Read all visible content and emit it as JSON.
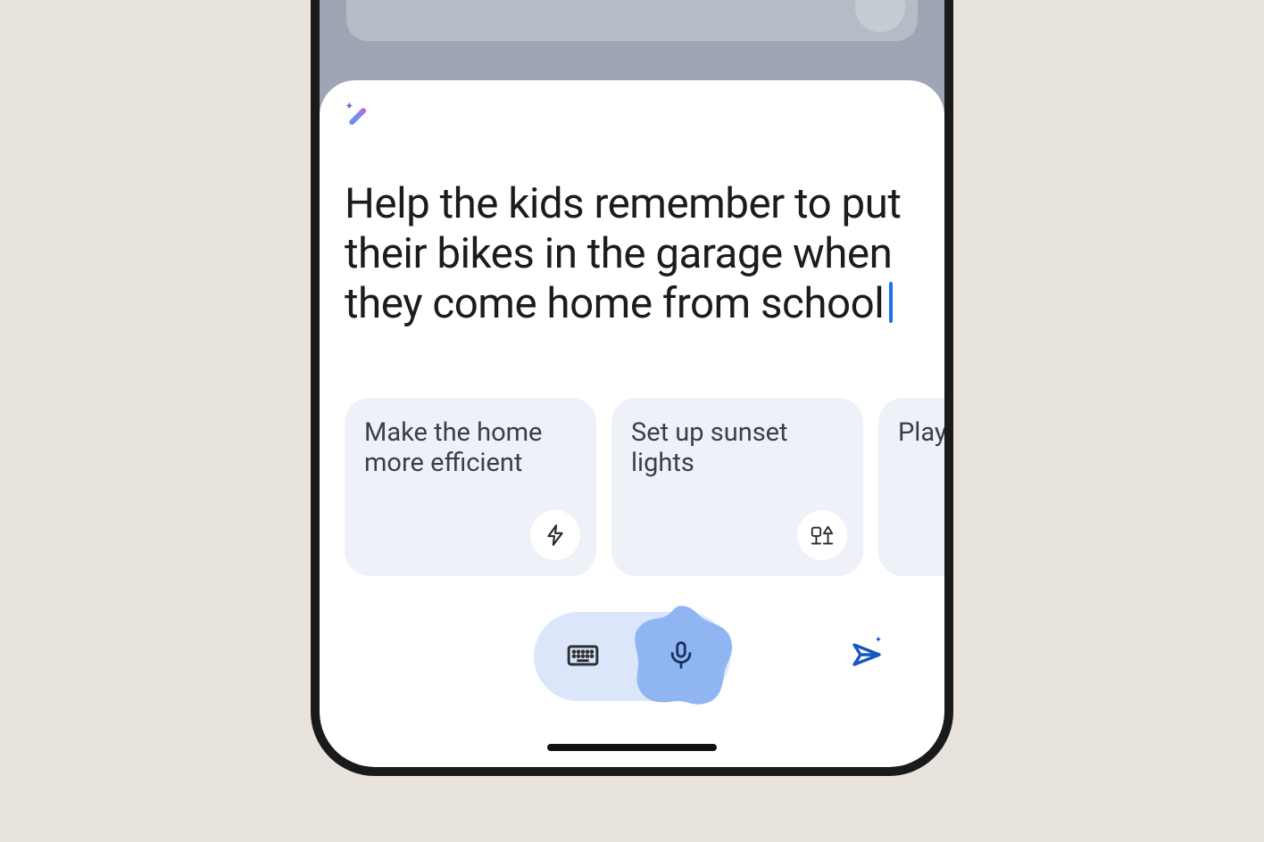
{
  "sheet": {
    "prompt_text": "Help the kids remember to put their bikes in the garage when they come home from school"
  },
  "suggestions": [
    {
      "label": "Make the home more efficient",
      "icon": "bolt"
    },
    {
      "label": "Set up sunset lights",
      "icon": "lamp"
    },
    {
      "label": "Play s when",
      "icon": "play"
    }
  ],
  "colors": {
    "accent": "#1a73e8",
    "mic_blob": "#8fb6f2",
    "card_bg": "#eef2f8",
    "pill_bg": "#dbe6fb"
  }
}
